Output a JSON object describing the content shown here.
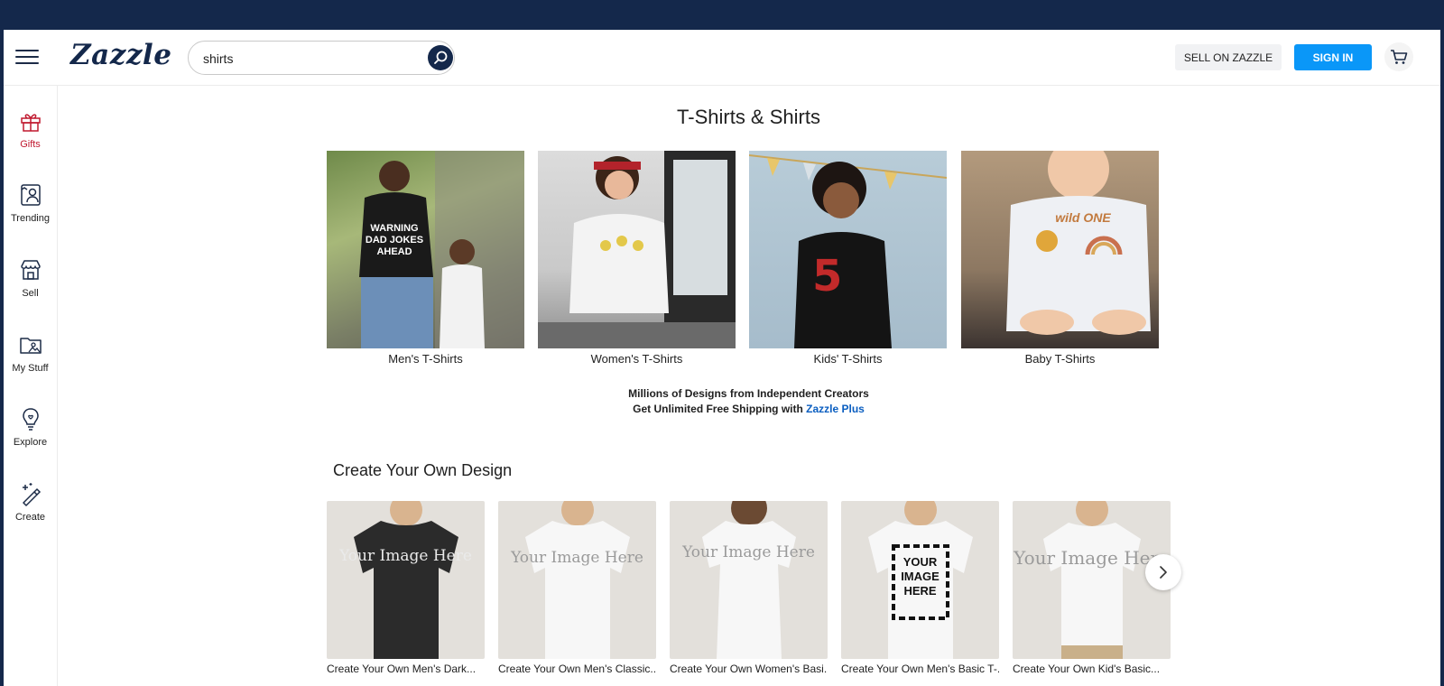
{
  "header": {
    "logo": "Zazzle",
    "search_value": "shirts",
    "sell_label": "SELL ON ZAZZLE",
    "signin_label": "SIGN IN"
  },
  "sidebar": {
    "items": [
      {
        "label": "Gifts",
        "icon": "gift-icon"
      },
      {
        "label": "Trending",
        "icon": "trending-icon"
      },
      {
        "label": "Sell",
        "icon": "store-icon"
      },
      {
        "label": "My Stuff",
        "icon": "folder-icon"
      },
      {
        "label": "Explore",
        "icon": "lightbulb-icon"
      },
      {
        "label": "Create",
        "icon": "magic-wand-icon"
      }
    ]
  },
  "main": {
    "title": "T-Shirts & Shirts",
    "categories": [
      {
        "label": "Men's T-Shirts",
        "shirt_text": "WARNING DAD JOKES AHEAD"
      },
      {
        "label": "Women's T-Shirts"
      },
      {
        "label": "Kids' T-Shirts"
      },
      {
        "label": "Baby T-Shirts",
        "shirt_text": "wild ONE"
      }
    ],
    "promo_line1": "Millions of Designs from Independent Creators",
    "promo_line2": "Get Unlimited Free Shipping with ",
    "promo_link": "Zazzle Plus",
    "section_title": "Create Your Own Design",
    "products": [
      {
        "label": "Create Your Own Men's Dark...",
        "image_text": "Your Image Here"
      },
      {
        "label": "Create Your Own Men's Classic...",
        "image_text": "Your Image Here"
      },
      {
        "label": "Create Your Own Women's Basi...",
        "image_text": "Your Image Here"
      },
      {
        "label": "Create Your Own Men's Basic T-...",
        "image_text": "YOUR IMAGE HERE"
      },
      {
        "label": "Create Your Own Kid's Basic...",
        "image_text": "Your Image Here"
      }
    ]
  },
  "colors": {
    "brand_navy": "#14284b",
    "signin_blue": "#0a97f8",
    "active_red": "#c0192f",
    "link_blue": "#0a5ec0"
  }
}
